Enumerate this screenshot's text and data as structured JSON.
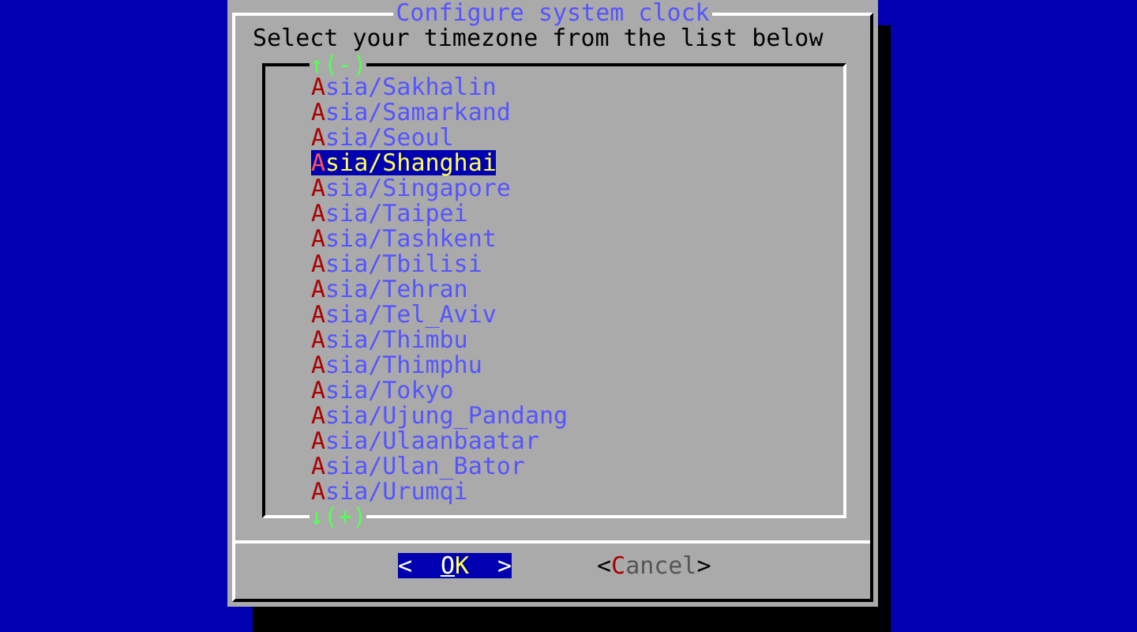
{
  "window": {
    "title": "Configure system clock",
    "prompt": "Select your timezone from the list below"
  },
  "list": {
    "scroll_up": "↑(-)",
    "scroll_down": "↓(+)",
    "items": [
      {
        "label": "Asia/Sakhalin",
        "selected": false
      },
      {
        "label": "Asia/Samarkand",
        "selected": false
      },
      {
        "label": "Asia/Seoul",
        "selected": false
      },
      {
        "label": "Asia/Shanghai",
        "selected": true
      },
      {
        "label": "Asia/Singapore",
        "selected": false
      },
      {
        "label": "Asia/Taipei",
        "selected": false
      },
      {
        "label": "Asia/Tashkent",
        "selected": false
      },
      {
        "label": "Asia/Tbilisi",
        "selected": false
      },
      {
        "label": "Asia/Tehran",
        "selected": false
      },
      {
        "label": "Asia/Tel_Aviv",
        "selected": false
      },
      {
        "label": "Asia/Thimbu",
        "selected": false
      },
      {
        "label": "Asia/Thimphu",
        "selected": false
      },
      {
        "label": "Asia/Tokyo",
        "selected": false
      },
      {
        "label": "Asia/Ujung_Pandang",
        "selected": false
      },
      {
        "label": "Asia/Ulaanbaatar",
        "selected": false
      },
      {
        "label": "Asia/Ulan_Bator",
        "selected": false
      },
      {
        "label": "Asia/Urumqi",
        "selected": false
      }
    ]
  },
  "buttons": [
    {
      "label": "OK",
      "left_bracket": "<",
      "right_bracket": ">",
      "selected": true
    },
    {
      "label": "Cancel",
      "left_bracket": "<",
      "right_bracket": ">",
      "selected": false
    }
  ]
}
